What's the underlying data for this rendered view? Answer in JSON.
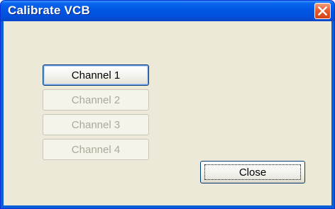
{
  "window": {
    "title": "Calibrate VCB",
    "close_icon": "close-icon",
    "accent_color": "#0054e3",
    "close_color": "#e0552b"
  },
  "buttons": {
    "channel1": {
      "label": "Channel 1",
      "enabled": true
    },
    "channel2": {
      "label": "Channel 2",
      "enabled": false
    },
    "channel3": {
      "label": "Channel 3",
      "enabled": false
    },
    "channel4": {
      "label": "Channel 4",
      "enabled": false
    },
    "close": {
      "label": "Close",
      "enabled": true
    }
  }
}
